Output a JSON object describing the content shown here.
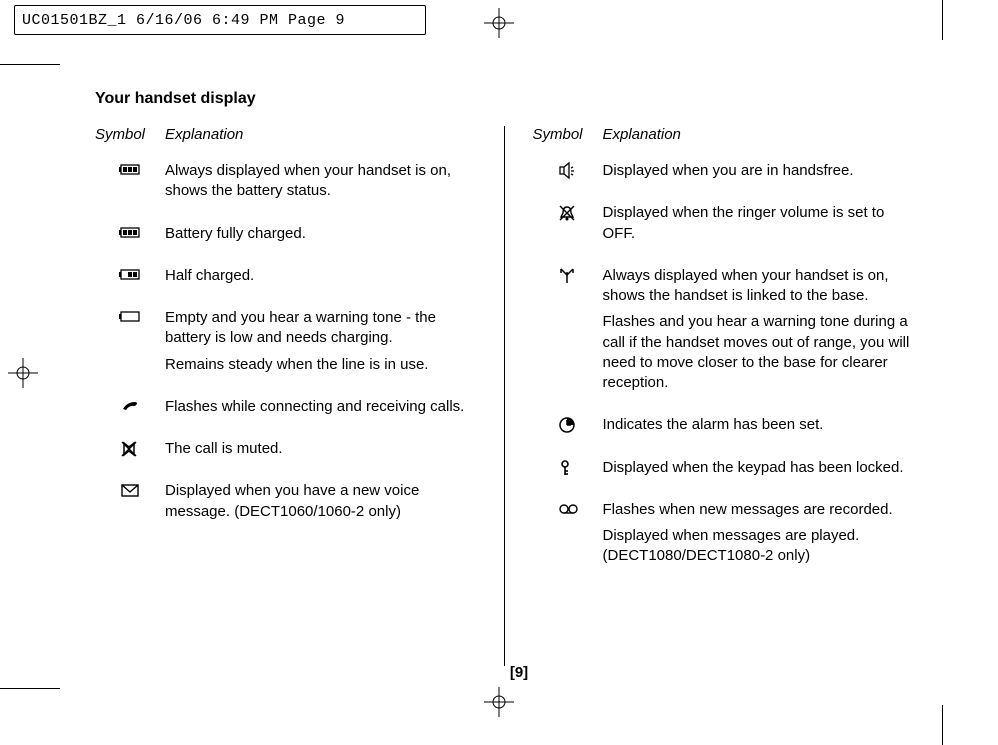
{
  "crop_header": "UC01501BZ_1  6/16/06  6:49 PM  Page 9",
  "title": "Your handset display",
  "header_symbol": "Symbol",
  "header_explanation": "Explanation",
  "page_number": "[9]",
  "left": [
    {
      "icon": "battery-full",
      "paras": [
        "Always displayed when your handset is on, shows the battery status."
      ]
    },
    {
      "icon": "battery-full",
      "paras": [
        "Battery fully charged."
      ]
    },
    {
      "icon": "battery-half",
      "paras": [
        "Half charged."
      ]
    },
    {
      "icon": "battery-empty",
      "paras": [
        "Empty and you hear a warning tone - the battery is low and needs charging.",
        "Remains steady when the line is in use."
      ]
    },
    {
      "icon": "call",
      "paras": [
        "Flashes while connecting and receiving calls."
      ]
    },
    {
      "icon": "mute",
      "paras": [
        "The call is muted."
      ]
    },
    {
      "icon": "envelope",
      "paras": [
        "Displayed when you have a new voice message. (DECT1060/1060-2 only)"
      ]
    }
  ],
  "right": [
    {
      "icon": "handsfree",
      "paras": [
        "Displayed when you are in handsfree."
      ]
    },
    {
      "icon": "bell-off",
      "paras": [
        "Displayed when the ringer volume is set to OFF."
      ]
    },
    {
      "icon": "antenna",
      "paras": [
        "Always displayed when your handset is on, shows the handset is linked to the base.",
        "Flashes and you hear a warning tone during a call if the handset moves out of range, you will need to move closer to the base for clearer reception."
      ]
    },
    {
      "icon": "clock",
      "paras": [
        "Indicates the alarm has been set."
      ]
    },
    {
      "icon": "key",
      "paras": [
        "Displayed when the keypad has been locked."
      ]
    },
    {
      "icon": "tape",
      "paras": [
        "Flashes when new messages are recorded.",
        "Displayed when messages are played. (DECT1080/DECT1080-2 only)"
      ]
    }
  ]
}
